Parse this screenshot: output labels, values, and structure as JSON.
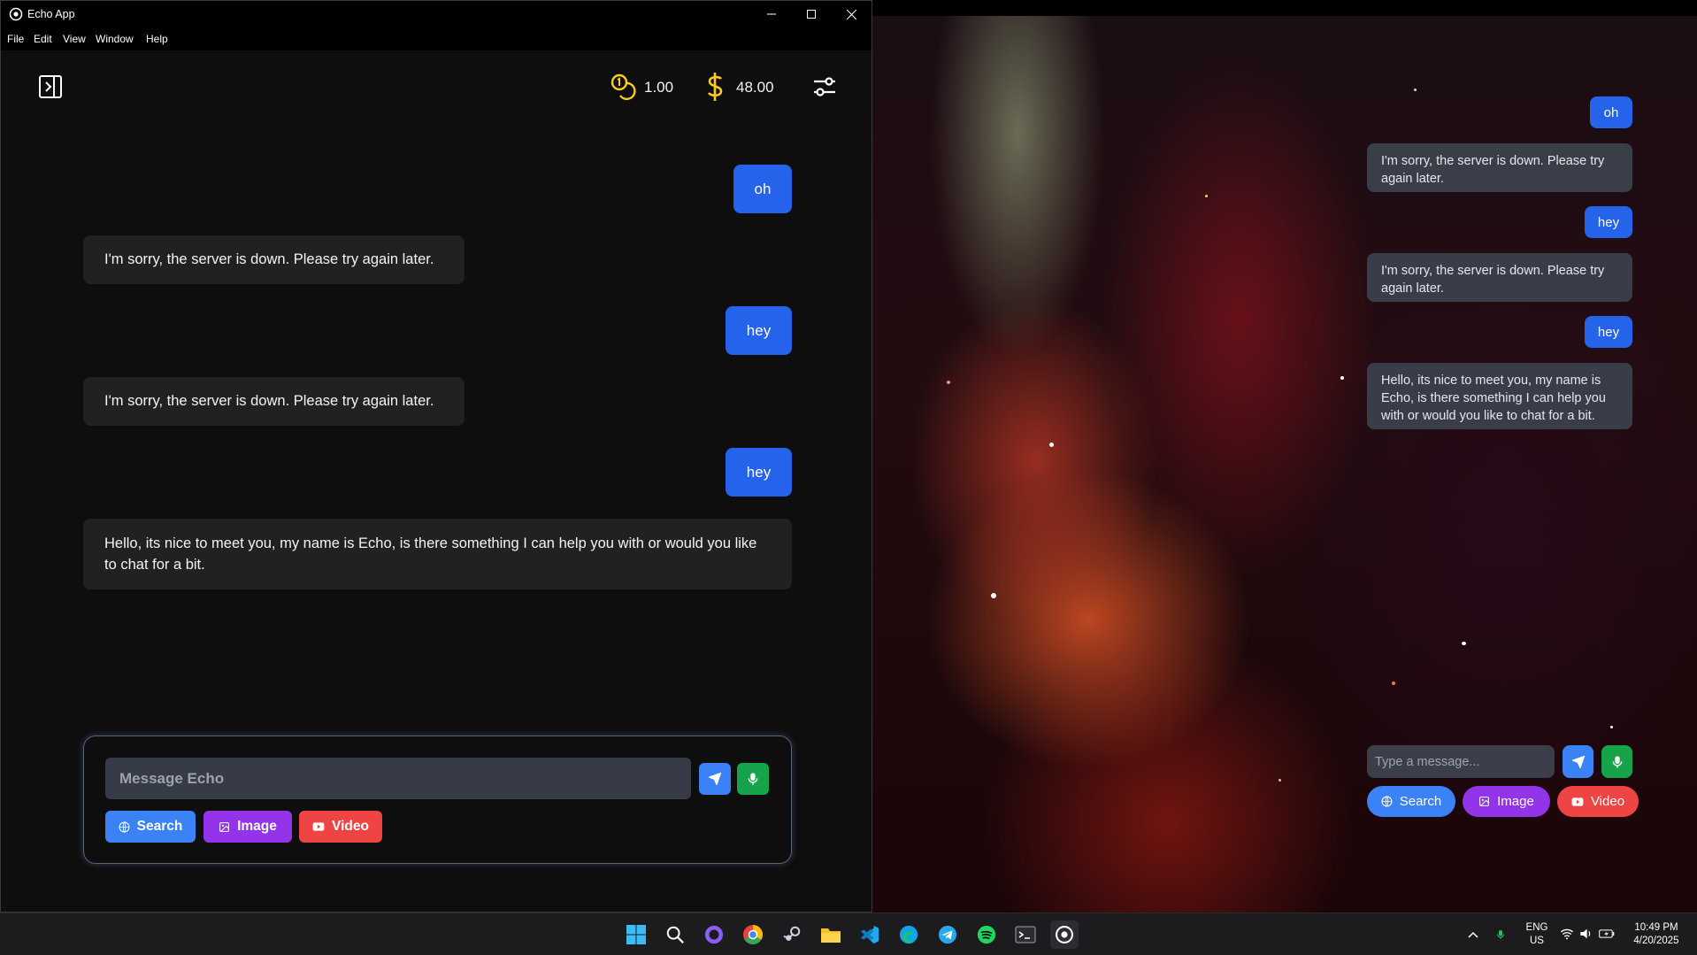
{
  "window": {
    "title": "Echo App",
    "menu": [
      "File",
      "Edit",
      "View",
      "Window",
      "Help"
    ]
  },
  "header": {
    "credits_value": "1.00",
    "balance_value": "48.00"
  },
  "chat": {
    "messages": [
      {
        "role": "user",
        "text": "oh"
      },
      {
        "role": "assistant",
        "text": "I'm sorry, the server is down. Please try again later."
      },
      {
        "role": "user",
        "text": "hey"
      },
      {
        "role": "assistant",
        "text": "I'm sorry, the server is down. Please try again later."
      },
      {
        "role": "user",
        "text": "hey"
      },
      {
        "role": "assistant",
        "text": "Hello, its nice to meet you, my name is Echo, is there something I can help you with or would you like to chat for a bit."
      }
    ]
  },
  "composer": {
    "placeholder": "Message Echo",
    "search_label": "Search",
    "image_label": "Image",
    "video_label": "Video"
  },
  "widget": {
    "messages": [
      {
        "role": "user",
        "text": "oh"
      },
      {
        "role": "assistant",
        "text": "I'm sorry, the server is down. Please try again later."
      },
      {
        "role": "user",
        "text": "hey"
      },
      {
        "role": "assistant",
        "text": "I'm sorry, the server is down. Please try again later."
      },
      {
        "role": "user",
        "text": "hey"
      },
      {
        "role": "assistant",
        "text": "Hello, its nice to meet you, my name is Echo, is there something I can help you with or would you like to chat for a bit."
      }
    ],
    "placeholder": "Type a message...",
    "search_label": "Search",
    "image_label": "Image",
    "video_label": "Video"
  },
  "taskbar": {
    "icons": [
      "windows-start",
      "search",
      "github-desktop",
      "chrome",
      "steam",
      "file-explorer",
      "vscode",
      "edge",
      "telegram",
      "spotify",
      "terminal",
      "echo-app"
    ],
    "language": "ENG",
    "region": "US",
    "time": "10:49 PM",
    "date": "4/20/2025"
  },
  "colors": {
    "user_bubble": "#2563eb",
    "bot_bubble": "#212124",
    "search_button": "#3b82f6",
    "image_button": "#9333ea",
    "video_button": "#ef4444",
    "mic_button": "#16a34a",
    "send_button": "#3b82f6",
    "accent_gold": "#facc15"
  }
}
